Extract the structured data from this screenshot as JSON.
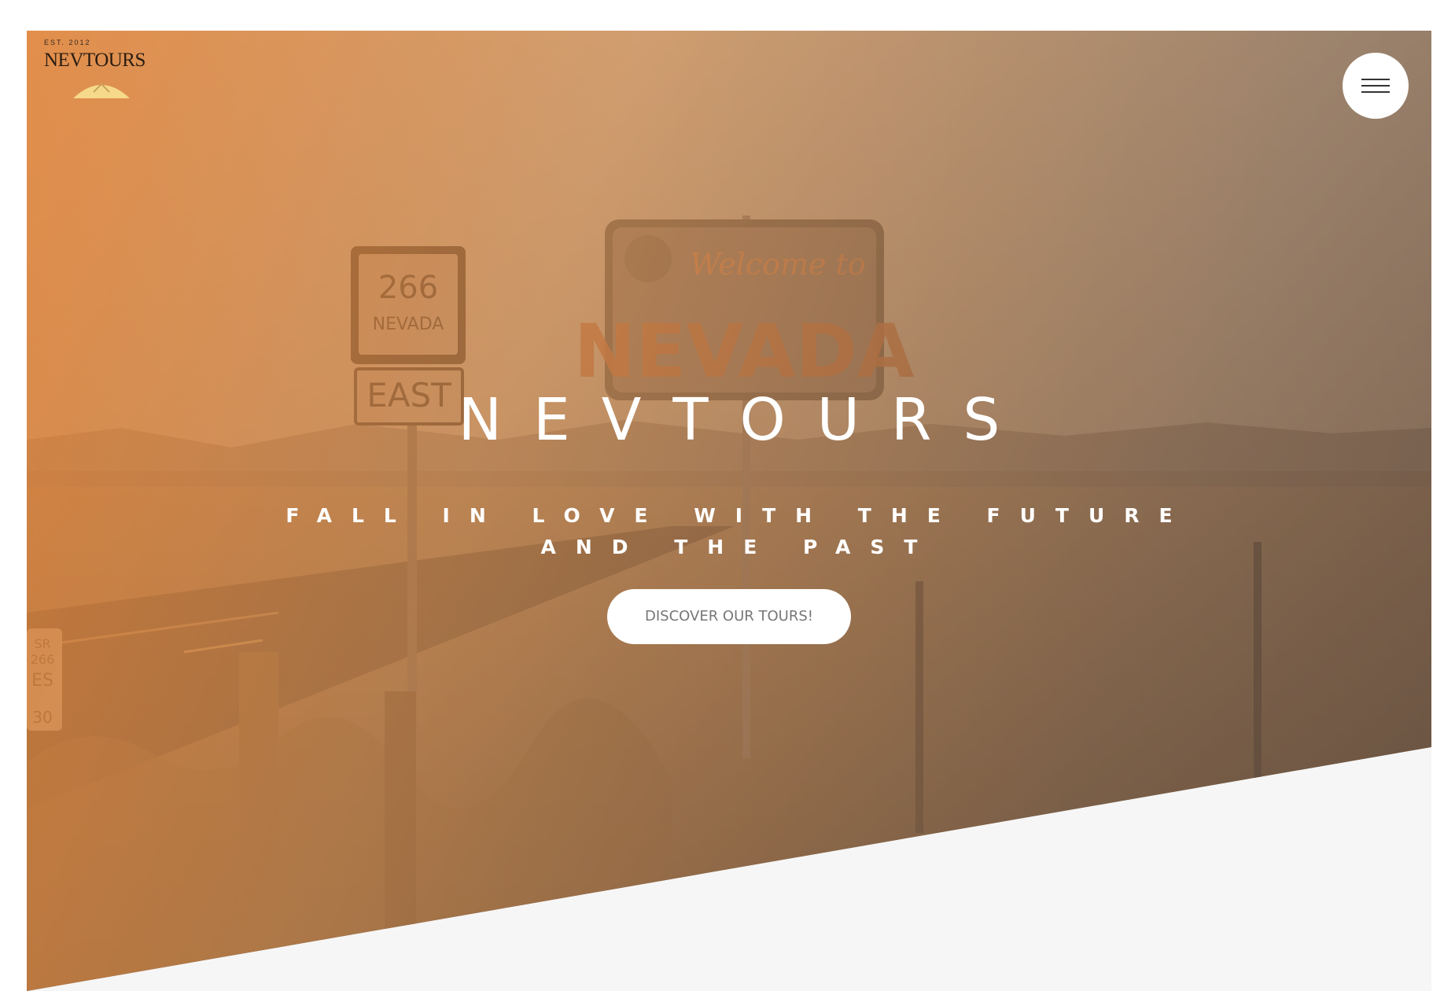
{
  "brand": {
    "logo_est": "EST. 2012",
    "logo_word": "NEVTOURS"
  },
  "menu": {
    "icon": "hamburger-menu-icon"
  },
  "hero": {
    "title": "NEVTOURS",
    "subtitle_line1": "FALL IN LOVE WITH THE FUTURE",
    "subtitle_line2": "AND THE PAST",
    "cta_label": "DISCOVER OUR TOURS!"
  },
  "background_signs": {
    "welcome_text": "Welcome to",
    "state_text": "NEVADA",
    "route_number": "266",
    "route_state": "NEVADA",
    "direction": "EAST",
    "post_text": "SR 266 ES 30"
  },
  "colors": {
    "overlay_start": "#e98434",
    "overlay_end": "#5a483c",
    "section_bg": "#f6f6f6",
    "button_bg": "#ffffff",
    "button_text": "#777777"
  }
}
